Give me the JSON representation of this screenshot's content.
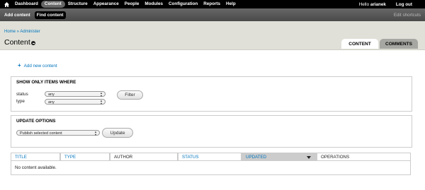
{
  "toolbar": {
    "items": [
      "Dashboard",
      "Content",
      "Structure",
      "Appearance",
      "People",
      "Modules",
      "Configuration",
      "Reports",
      "Help"
    ],
    "active": "Content",
    "hello": "Hello ",
    "user": "arianek",
    "logout": "Log out"
  },
  "shortcuts": {
    "items": [
      "Add content",
      "Find content"
    ],
    "edit": "Edit shortcuts"
  },
  "header": {
    "crumb_home": "Home",
    "crumb_sep": " » ",
    "crumb_admin": "Administer",
    "title": "Content",
    "tabs": [
      "CONTENT",
      "COMMENTS"
    ]
  },
  "add_link": "Add new content",
  "filter": {
    "title": "SHOW ONLY ITEMS WHERE",
    "status_label": "status",
    "status_value": "any",
    "type_label": "type",
    "type_value": "any",
    "button": "Filter"
  },
  "update": {
    "title": "UPDATE OPTIONS",
    "select_value": "Publish selected content",
    "button": "Update"
  },
  "table": {
    "headers": [
      "TITLE",
      "TYPE",
      "AUTHOR",
      "STATUS",
      "UPDATED",
      "OPERATIONS"
    ],
    "empty": "No content available."
  }
}
